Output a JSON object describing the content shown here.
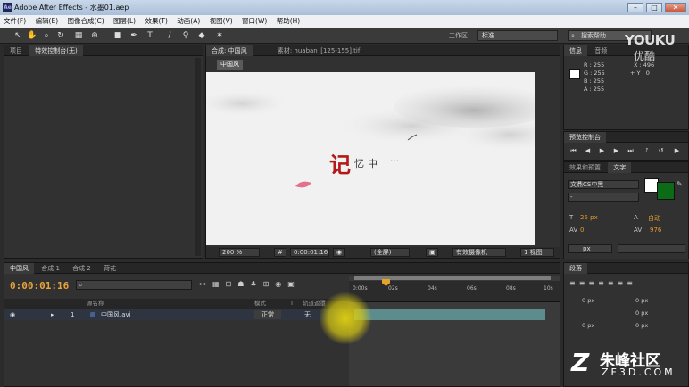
{
  "window": {
    "title": "Adobe After Effects - 水墨01.aep",
    "minimize": "–",
    "maximize": "□",
    "close": "✕"
  },
  "menu": [
    "文件(F)",
    "编辑(E)",
    "图像合成(C)",
    "图层(L)",
    "效果(T)",
    "动画(A)",
    "视图(V)",
    "窗口(W)",
    "帮助(H)"
  ],
  "toolbar": {
    "workspace_label": "工作区:",
    "workspace_value": "标准",
    "search_help": "搜索帮助"
  },
  "watermark_top": {
    "brand": "YOUKU",
    "sub": "优酷"
  },
  "project_panel": {
    "tabs": [
      "项目",
      "特效控制台(无)"
    ]
  },
  "comp_panel": {
    "tabs": [
      "合成: 中国风",
      "素材: huaban_[125-155].tif"
    ],
    "subtab": "中国风",
    "viewer_text": {
      "main": "记",
      "rest": "忆中",
      "tail": "…"
    },
    "controls": {
      "zoom": "200 %",
      "timecode": "0:00:01:16",
      "resolution": "(全屏)",
      "camera": "有效摄像机",
      "views": "1 视图",
      "offset": "+0.0"
    }
  },
  "info_panel": {
    "tabs": [
      "信息",
      "音频"
    ],
    "values": [
      "R : 255",
      "G : 255",
      "B : 255",
      "A : 255"
    ],
    "coords": [
      "X : 496",
      "+ Y : 0"
    ]
  },
  "preview_panel": {
    "tab": "预览控制台"
  },
  "char_panel": {
    "tabs": [
      "效果和预置",
      "文字"
    ],
    "font": "文鼎CS中黑",
    "font_style": "-",
    "size": "25 px",
    "leading": "自动",
    "kerning": "0",
    "tracking": "976",
    "stroke": "px",
    "color_fill": "#0b6b17"
  },
  "para_panel": {
    "tab": "段落",
    "indent_values": [
      "0 px",
      "0 px",
      "0 px",
      "0 px",
      "0 px"
    ]
  },
  "timeline": {
    "tabs": [
      "中国风",
      "合成 1",
      "合成 2",
      "荷花"
    ],
    "time": "0:00:01:16",
    "columns": [
      "源名称",
      "模式",
      "T",
      "轨道遮罩"
    ],
    "layer": {
      "index": "1",
      "name": "中国风.avi",
      "mode": "正常",
      "track": "无"
    },
    "ruler": [
      "0:00s",
      "02s",
      "04s",
      "06s",
      "08s",
      "10s"
    ]
  },
  "watermark_bottom": {
    "brand": "朱峰社区",
    "sub": "ZF3D.COM"
  }
}
